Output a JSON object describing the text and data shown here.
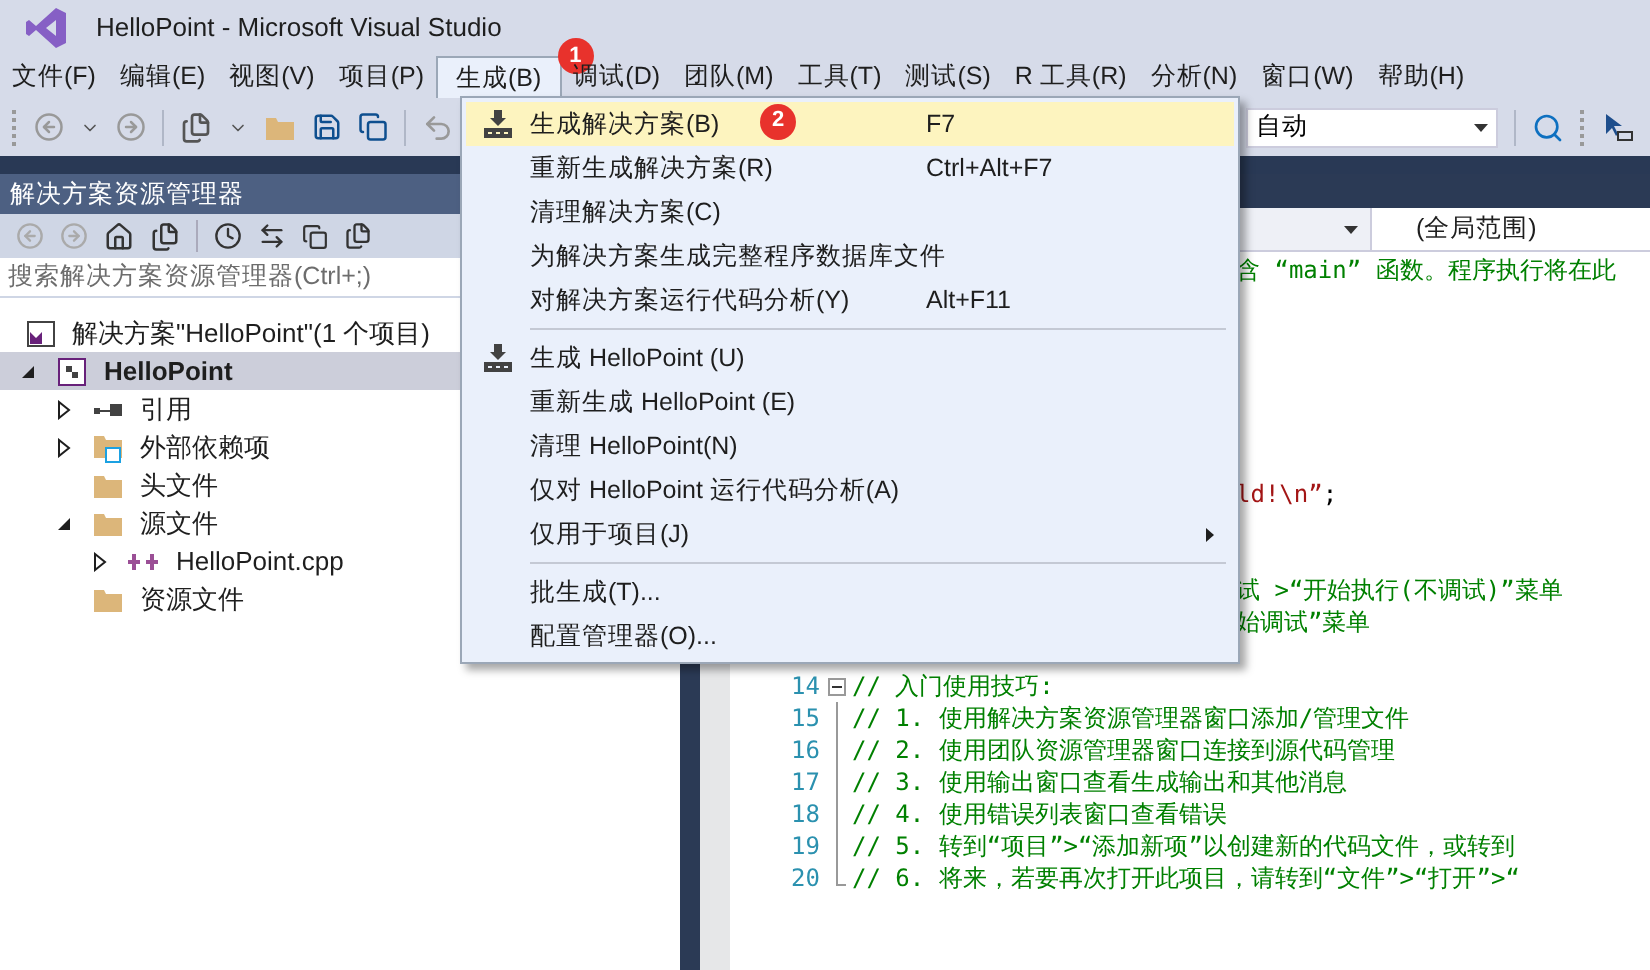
{
  "window": {
    "title": "HelloPoint - Microsoft Visual Studio"
  },
  "menubar": [
    {
      "label": "文件(F)",
      "selected": false
    },
    {
      "label": "编辑(E)",
      "selected": false
    },
    {
      "label": "视图(V)",
      "selected": false
    },
    {
      "label": "项目(P)",
      "selected": false
    },
    {
      "label": "生成(B)",
      "selected": true,
      "badge": "1"
    },
    {
      "label": "调试(D)",
      "selected": false
    },
    {
      "label": "团队(M)",
      "selected": false
    },
    {
      "label": "工具(T)",
      "selected": false
    },
    {
      "label": "测试(S)",
      "selected": false
    },
    {
      "label": "R 工具(R)",
      "selected": false
    },
    {
      "label": "分析(N)",
      "selected": false
    },
    {
      "label": "窗口(W)",
      "selected": false
    },
    {
      "label": "帮助(H)",
      "selected": false
    }
  ],
  "toolbar": {
    "platform_dropdown": "自动"
  },
  "build_menu": {
    "groups": [
      [
        {
          "label": "生成解决方案(B)",
          "shortcut": "F7",
          "icon": true,
          "selected": true,
          "badge": "2"
        },
        {
          "label": "重新生成解决方案(R)",
          "shortcut": "Ctrl+Alt+F7",
          "icon": false,
          "selected": false
        },
        {
          "label": "清理解决方案(C)",
          "icon": false,
          "selected": false
        },
        {
          "label": "为解决方案生成完整程序数据库文件",
          "icon": false,
          "selected": false
        },
        {
          "label": "对解决方案运行代码分析(Y)",
          "shortcut": "Alt+F11",
          "icon": false,
          "selected": false
        }
      ],
      [
        {
          "label": "生成 HelloPoint (U)",
          "icon": true,
          "selected": false
        },
        {
          "label": "重新生成 HelloPoint (E)",
          "icon": false,
          "selected": false
        },
        {
          "label": "清理 HelloPoint(N)",
          "icon": false,
          "selected": false
        },
        {
          "label": "仅对 HelloPoint 运行代码分析(A)",
          "icon": false,
          "selected": false
        },
        {
          "label": "仅用于项目(J)",
          "icon": false,
          "selected": false,
          "submenu": true
        }
      ],
      [
        {
          "label": "批生成(T)...",
          "icon": false,
          "selected": false
        },
        {
          "label": "配置管理器(O)...",
          "icon": false,
          "selected": false
        }
      ]
    ]
  },
  "solution_explorer": {
    "title": "解决方案资源管理器",
    "search": {
      "placeholder": "搜索解决方案资源管理器(Ctrl+;)"
    },
    "tree": [
      {
        "label": "解决方案\"HelloPoint\"(1 个项目)",
        "kind": "solution",
        "selected": false,
        "children": [
          {
            "label": "HelloPoint",
            "kind": "project",
            "selected": true,
            "expanded": true,
            "children": [
              {
                "label": "引用",
                "kind": "references",
                "selected": false,
                "expanded": false
              },
              {
                "label": "外部依赖项",
                "kind": "external",
                "selected": false,
                "expanded": false
              },
              {
                "label": "头文件",
                "kind": "folder",
                "selected": false
              },
              {
                "label": "源文件",
                "kind": "folder",
                "selected": false,
                "expanded": true,
                "children": [
                  {
                    "label": "HelloPoint.cpp",
                    "kind": "cpp",
                    "selected": false,
                    "expanded": false
                  }
                ]
              },
              {
                "label": "资源文件",
                "kind": "folder",
                "selected": false
              }
            ]
          }
        ]
      }
    ]
  },
  "editor": {
    "scope_dropdown": "(全局范围)",
    "covered_lines": [
      {
        "parts": [
          {
            "kind": "comment",
            "text": "含 “main” 函数。程序执行将在此"
          }
        ]
      },
      {
        "parts": [
          {
            "kind": "string",
            "text": "ld!\\n”"
          },
          {
            "kind": "plain",
            "text": ";"
          }
        ]
      },
      {
        "parts": [
          {
            "kind": "comment",
            "text": "试 >“开始执行(不调试)”菜单"
          }
        ]
      },
      {
        "parts": [
          {
            "kind": "comment",
            "text": "始调试”菜单"
          }
        ]
      }
    ],
    "lines": [
      {
        "number": "14",
        "kind": "fold_start",
        "parts": [
          {
            "kind": "comment",
            "text": "// 入门使用技巧:"
          }
        ]
      },
      {
        "number": "15",
        "kind": "fold_line",
        "parts": [
          {
            "kind": "comment",
            "text": "//   1. 使用解决方案资源管理器窗口添加/管理文件"
          }
        ]
      },
      {
        "number": "16",
        "kind": "fold_line",
        "parts": [
          {
            "kind": "comment",
            "text": "//   2. 使用团队资源管理器窗口连接到源代码管理"
          }
        ]
      },
      {
        "number": "17",
        "kind": "fold_line",
        "parts": [
          {
            "kind": "comment",
            "text": "//   3. 使用输出窗口查看生成输出和其他消息"
          }
        ]
      },
      {
        "number": "18",
        "kind": "fold_line",
        "parts": [
          {
            "kind": "comment",
            "text": "//   4. 使用错误列表窗口查看错误"
          }
        ]
      },
      {
        "number": "19",
        "kind": "fold_line",
        "parts": [
          {
            "kind": "comment",
            "text": "//   5. 转到“项目”>“添加新项”以创建新的代码文件，或转到"
          }
        ]
      },
      {
        "number": "20",
        "kind": "fold_end",
        "parts": [
          {
            "kind": "comment",
            "text": "//   6. 将来，若要再次打开此项目，请转到“文件”>“打开”>“"
          }
        ]
      }
    ]
  }
}
